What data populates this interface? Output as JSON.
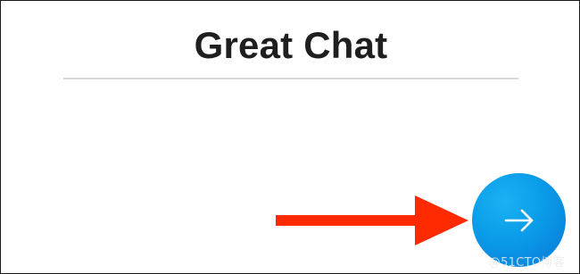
{
  "header": {
    "title": "Great Chat"
  },
  "action_button": {
    "icon": "arrow-right-icon",
    "color": "#0a9be8"
  },
  "annotation": {
    "arrow_color": "#ff2a00"
  },
  "watermark": {
    "text": "@51CTO博客"
  }
}
